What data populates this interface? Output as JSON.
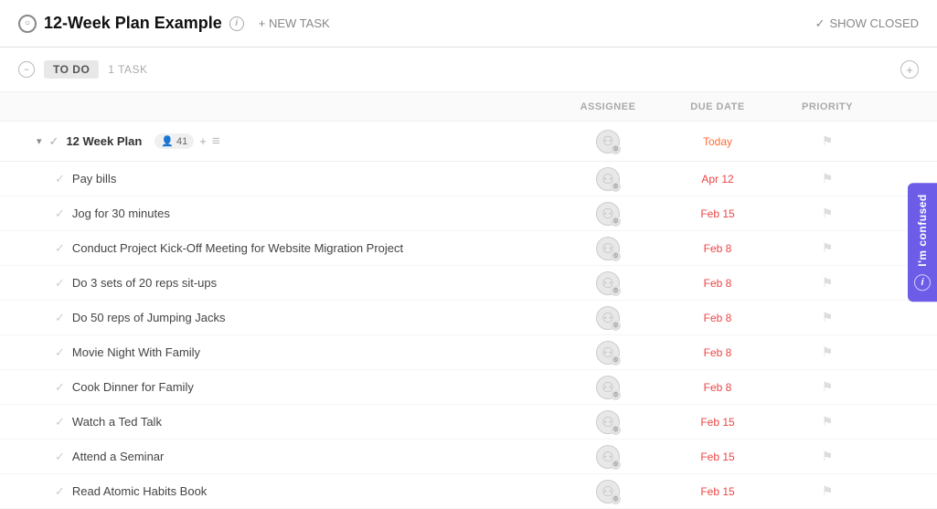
{
  "header": {
    "circle_icon": "○",
    "title": "12-Week Plan Example",
    "new_task_label": "+ NEW TASK",
    "show_closed_label": "SHOW CLOSED",
    "check_mark": "✓"
  },
  "section": {
    "label": "TO DO",
    "task_count": "1 TASK",
    "collapse_icon": "−",
    "add_icon": "+"
  },
  "columns": {
    "assignee": "ASSIGNEE",
    "due_date": "DUE DATE",
    "priority": "PRIORITY"
  },
  "parent_task": {
    "name": "12 Week Plan",
    "member_count": "41",
    "due": "Today",
    "due_class": "due-today"
  },
  "tasks": [
    {
      "name": "Pay bills",
      "due": "Apr 12",
      "due_class": "due-normal"
    },
    {
      "name": "Jog for 30 minutes",
      "due": "Feb 15",
      "due_class": "due-normal"
    },
    {
      "name": "Conduct Project Kick-Off Meeting for Website Migration Project",
      "due": "Feb 8",
      "due_class": "due-normal"
    },
    {
      "name": "Do 3 sets of 20 reps sit-ups",
      "due": "Feb 8",
      "due_class": "due-normal"
    },
    {
      "name": "Do 50 reps of Jumping Jacks",
      "due": "Feb 8",
      "due_class": "due-normal"
    },
    {
      "name": "Movie Night With Family",
      "due": "Feb 8",
      "due_class": "due-normal"
    },
    {
      "name": "Cook Dinner for Family",
      "due": "Feb 8",
      "due_class": "due-normal"
    },
    {
      "name": "Watch a Ted Talk",
      "due": "Feb 15",
      "due_class": "due-normal"
    },
    {
      "name": "Attend a Seminar",
      "due": "Feb 15",
      "due_class": "due-normal"
    },
    {
      "name": "Read Atomic Habits Book",
      "due": "Feb 15",
      "due_class": "due-normal"
    }
  ],
  "feedback": {
    "label": "I'm confused",
    "info": "i"
  }
}
